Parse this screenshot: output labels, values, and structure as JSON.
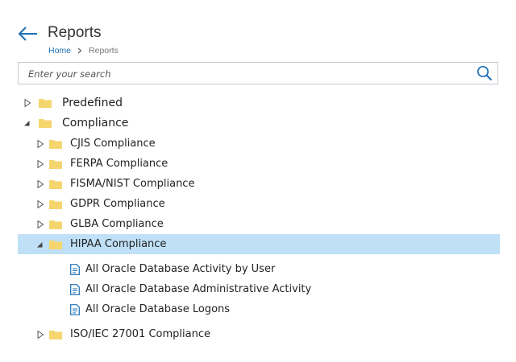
{
  "header": {
    "title": "Reports",
    "breadcrumb": {
      "home": "Home",
      "current": "Reports"
    }
  },
  "search": {
    "placeholder": "Enter your search",
    "value": ""
  },
  "tree": {
    "predefined": {
      "label": "Predefined",
      "state": "collapsed"
    },
    "compliance": {
      "label": "Compliance",
      "state": "expanded",
      "children": {
        "cjis": {
          "label": "CJIS Compliance",
          "state": "collapsed"
        },
        "ferpa": {
          "label": "FERPA Compliance",
          "state": "collapsed"
        },
        "fisma": {
          "label": "FISMA/NIST Compliance",
          "state": "collapsed"
        },
        "gdpr": {
          "label": "GDPR Compliance",
          "state": "collapsed"
        },
        "glba": {
          "label": "GLBA Compliance",
          "state": "collapsed"
        },
        "hipaa": {
          "label": "HIPAA Compliance",
          "state": "expanded",
          "selected": true,
          "reports": [
            "All Oracle Database Activity by User",
            "All Oracle Database Administrative Activity",
            "All Oracle Database Logons"
          ]
        },
        "iso": {
          "label": "ISO/IEC 27001 Compliance",
          "state": "collapsed"
        }
      }
    }
  },
  "colors": {
    "accent": "#1a6fb5",
    "selection": "#bfe0f6",
    "folder": "#f5d56e",
    "border": "#c4ccd3"
  }
}
